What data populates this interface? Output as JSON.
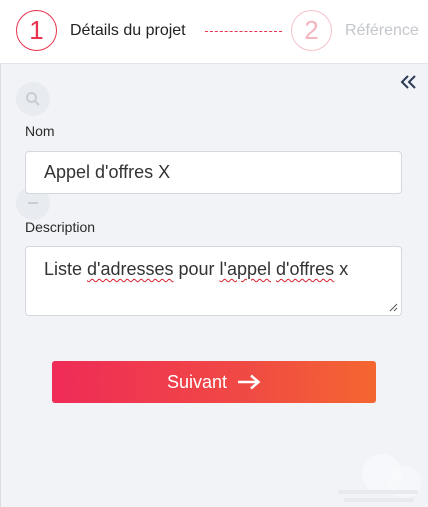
{
  "stepper": {
    "step1": {
      "number": "1",
      "label": "Détails du projet"
    },
    "step2": {
      "number": "2",
      "label": "Référence"
    }
  },
  "form": {
    "nom": {
      "label": "Nom",
      "value": "Appel d'offres X"
    },
    "description": {
      "label": "Description",
      "value_parts": [
        "Liste ",
        "d'adresses",
        " pour ",
        "l'appel",
        " ",
        "d'offres",
        " x"
      ]
    }
  },
  "actions": {
    "next_label": "Suivant"
  },
  "colors": {
    "accent": "#e8344e",
    "gradient_start": "#ef2b57",
    "gradient_end": "#f46630"
  },
  "icons": [
    "collapse-double-chevron-icon",
    "search-icon",
    "minus-icon",
    "arrow-right-icon"
  ]
}
